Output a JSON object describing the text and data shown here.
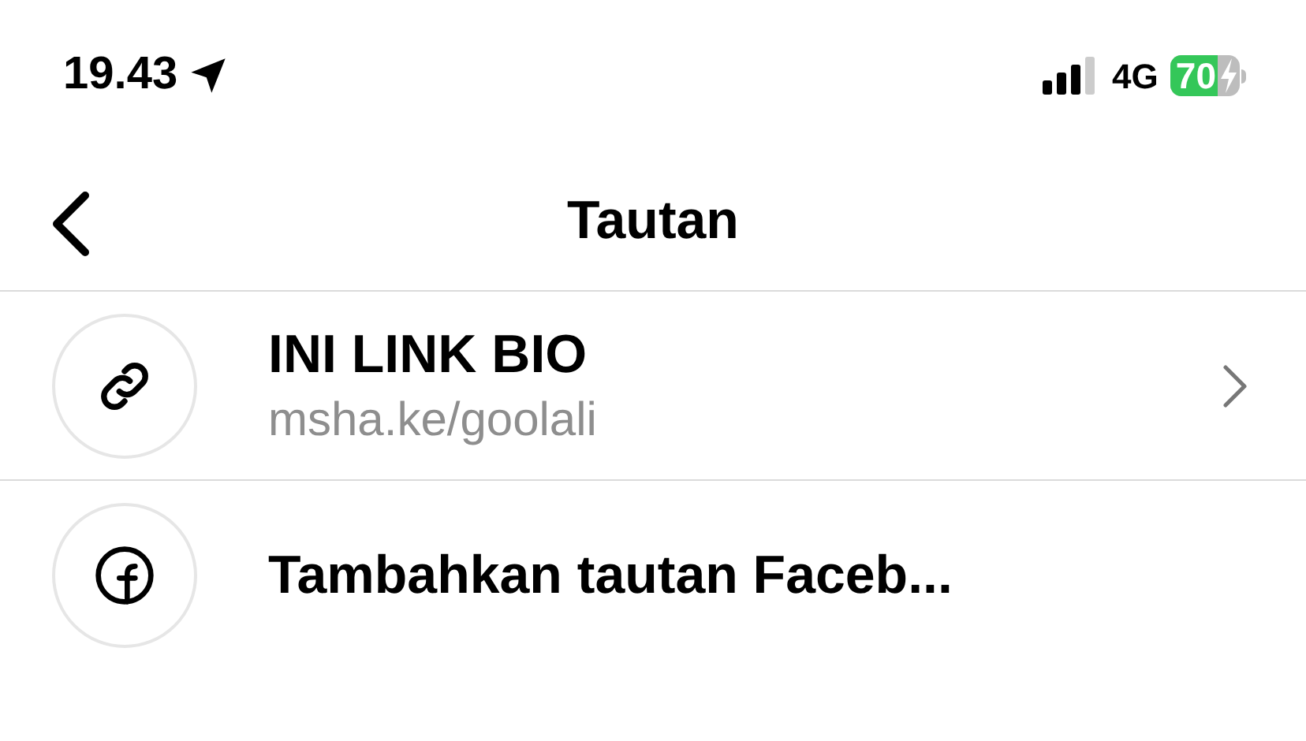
{
  "status_bar": {
    "time": "19.43",
    "network": "4G",
    "battery": "70",
    "charging": true
  },
  "nav": {
    "title": "Tautan"
  },
  "rows": [
    {
      "kind": "link",
      "title": "INI LINK BIO",
      "subtitle": "msha.ke/goolali"
    },
    {
      "kind": "facebook",
      "title": "Tambahkan tautan Faceb..."
    }
  ]
}
